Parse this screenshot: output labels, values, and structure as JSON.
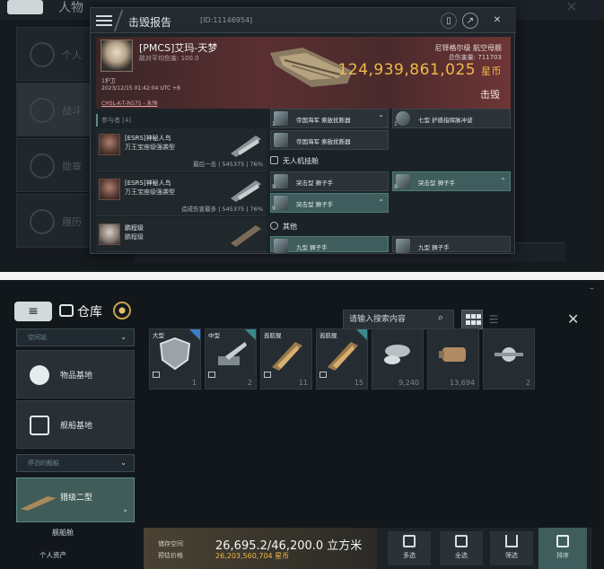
{
  "top_window": {
    "bg_title": "人物",
    "bg_side_items": [
      "个人",
      "战斗",
      "勋章",
      "履历"
    ],
    "kill_report": {
      "title": "击毁报告",
      "id": "[ID:11146954]",
      "pilot": {
        "name": "[PMCS]艾玛-天梦",
        "sub": "敌对平均伤害: 100.0",
        "tag": "1护卫",
        "datetime": "2023/12/15 01:42:04 UTC +8",
        "location": "CHSL-K-T-RG75 - 永恒"
      },
      "ship_class": "尼铎格尔级 航空母舰",
      "total_loss_label": "总伤害量: 711703",
      "isk_value": "124,939,861,025",
      "isk_unit": "星币",
      "status": "击毁",
      "attackers_header": "参与者 [4]",
      "attackers": [
        {
          "name": "[ESRS]神秘人鸟",
          "ship": "万王宝座级强袭型",
          "stat": "最后一击 | 545375 | 76%"
        },
        {
          "name": "[ESRS]神秘人鸟",
          "ship": "万王宝座级强袭型",
          "stat": "造成伤害最多 | 545375 | 76%"
        },
        {
          "name": "鹏程级",
          "ship": "鹏程级",
          "stat": ""
        }
      ],
      "fitting": {
        "slots": [
          {
            "label": "帝国海军 索敌扰断器",
            "qty": "1",
            "hl": false
          },
          {
            "label": "七型 护盾指挥脉冲波",
            "qty": "1",
            "hl": false
          },
          {
            "label": "帝国海军 索敌扰断器",
            "qty": "",
            "hl": false
          }
        ],
        "drone_section": "无人机挂舱",
        "drones": [
          {
            "label": "突击型 狮子手",
            "qty": "9",
            "hl": false
          },
          {
            "label": "突击型 狮子手",
            "qty": "9",
            "hl": true
          },
          {
            "label": "突击型 狮子手",
            "qty": "9",
            "hl": true
          }
        ],
        "other_section": "其他",
        "others": [
          {
            "label": "九型 狮子手",
            "qty": "",
            "hl": true
          },
          {
            "label": "九型 狮子手",
            "qty": "",
            "hl": false
          }
        ]
      }
    }
  },
  "warehouse": {
    "title": "仓库",
    "search_placeholder": "请输入搜索内容",
    "sidebar": {
      "dropdown1": "空间站",
      "dropdown2": "停泊的舰船",
      "categories": [
        {
          "label": "物品基地",
          "icon": "cube-icon"
        },
        {
          "label": "舰船基地",
          "icon": "hangar-icon"
        }
      ],
      "ship_item": "猎级二型",
      "bay_label": "舰船舱",
      "assets_label": "个人资产"
    },
    "items": [
      {
        "tag": "大型",
        "qty": "1",
        "icon": "shield-icon",
        "badge": "blue"
      },
      {
        "tag": "中型",
        "qty": "2",
        "icon": "turret-icon",
        "badge": "green"
      },
      {
        "tag": "巡航舰",
        "qty": "11",
        "icon": "ship-icon",
        "badge": ""
      },
      {
        "tag": "巡航舰",
        "qty": "15",
        "icon": "ship-icon",
        "badge": "green"
      },
      {
        "tag": "",
        "qty": "9,240",
        "icon": "ore-icon",
        "badge": ""
      },
      {
        "tag": "",
        "qty": "13,694",
        "icon": "canister-icon",
        "badge": ""
      },
      {
        "tag": "",
        "qty": "2",
        "icon": "drone-icon",
        "badge": ""
      }
    ],
    "footer": {
      "storage_label": "储存空间",
      "estimate_label": "预估价格",
      "storage_value": "26,695.2/46,200.0 立方米",
      "estimate_value": "26,203,560,704 星币",
      "actions": [
        "多选",
        "全选",
        "筛选",
        "排序"
      ]
    }
  }
}
